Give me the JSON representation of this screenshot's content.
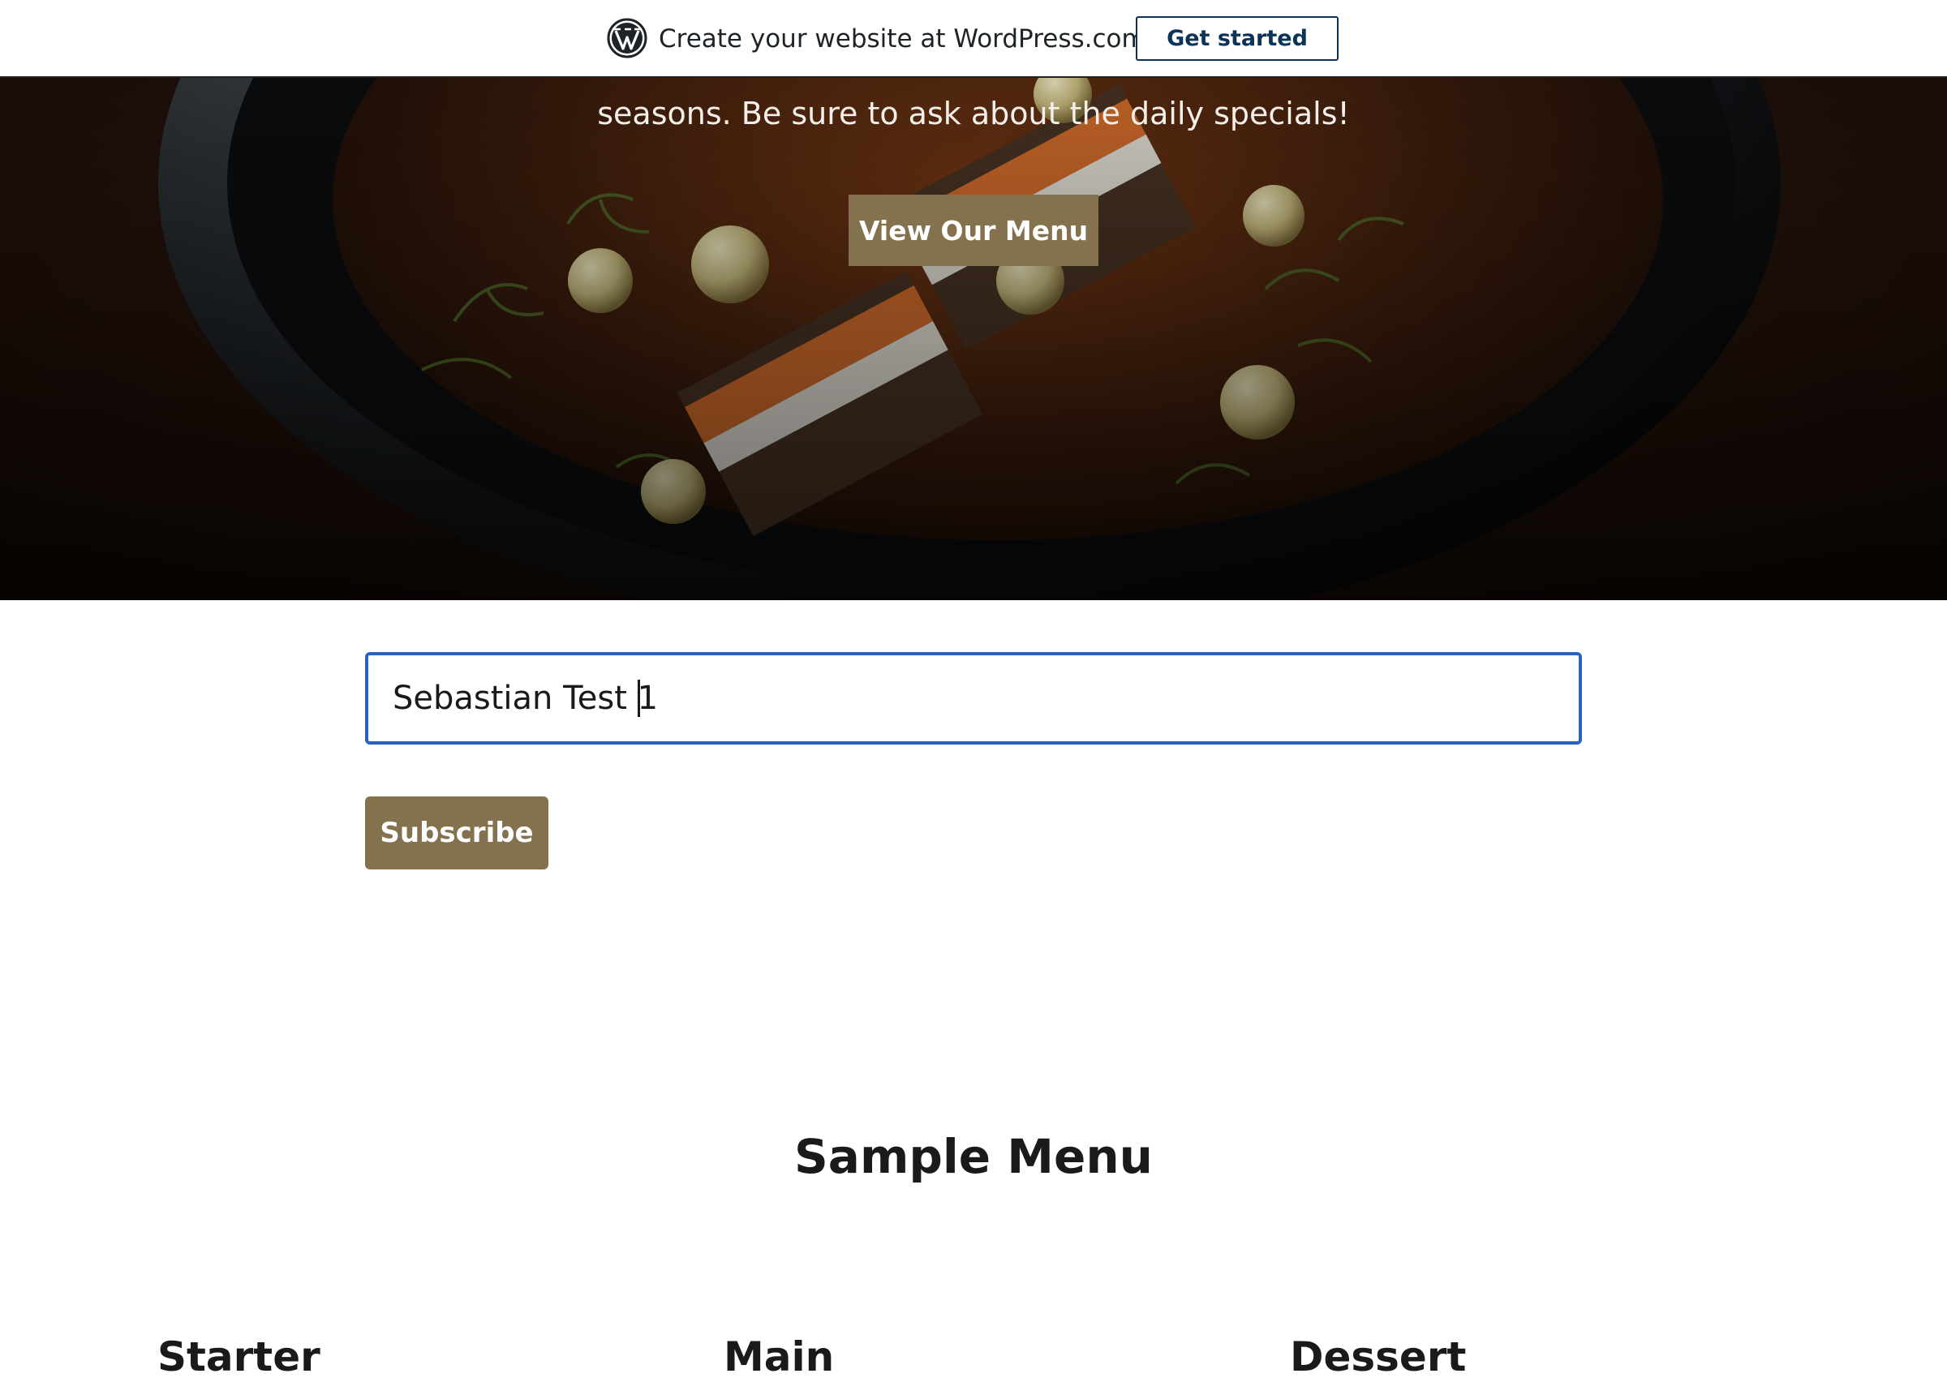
{
  "wp_banner": {
    "text": "Create your website at WordPress.com",
    "button_label": "Get started"
  },
  "hero": {
    "tagline": "seasons. Be sure to ask about the daily specials!",
    "button_label": "View Our Menu"
  },
  "subscribe": {
    "input_value": "Sebastian Test 1",
    "button_label": "Subscribe"
  },
  "menu": {
    "title": "Sample Menu",
    "courses": [
      "Starter",
      "Main",
      "Dessert"
    ]
  },
  "colors": {
    "accent": "#84714d",
    "focus_border": "#2a62bd",
    "wp_blue": "#0b3357"
  }
}
